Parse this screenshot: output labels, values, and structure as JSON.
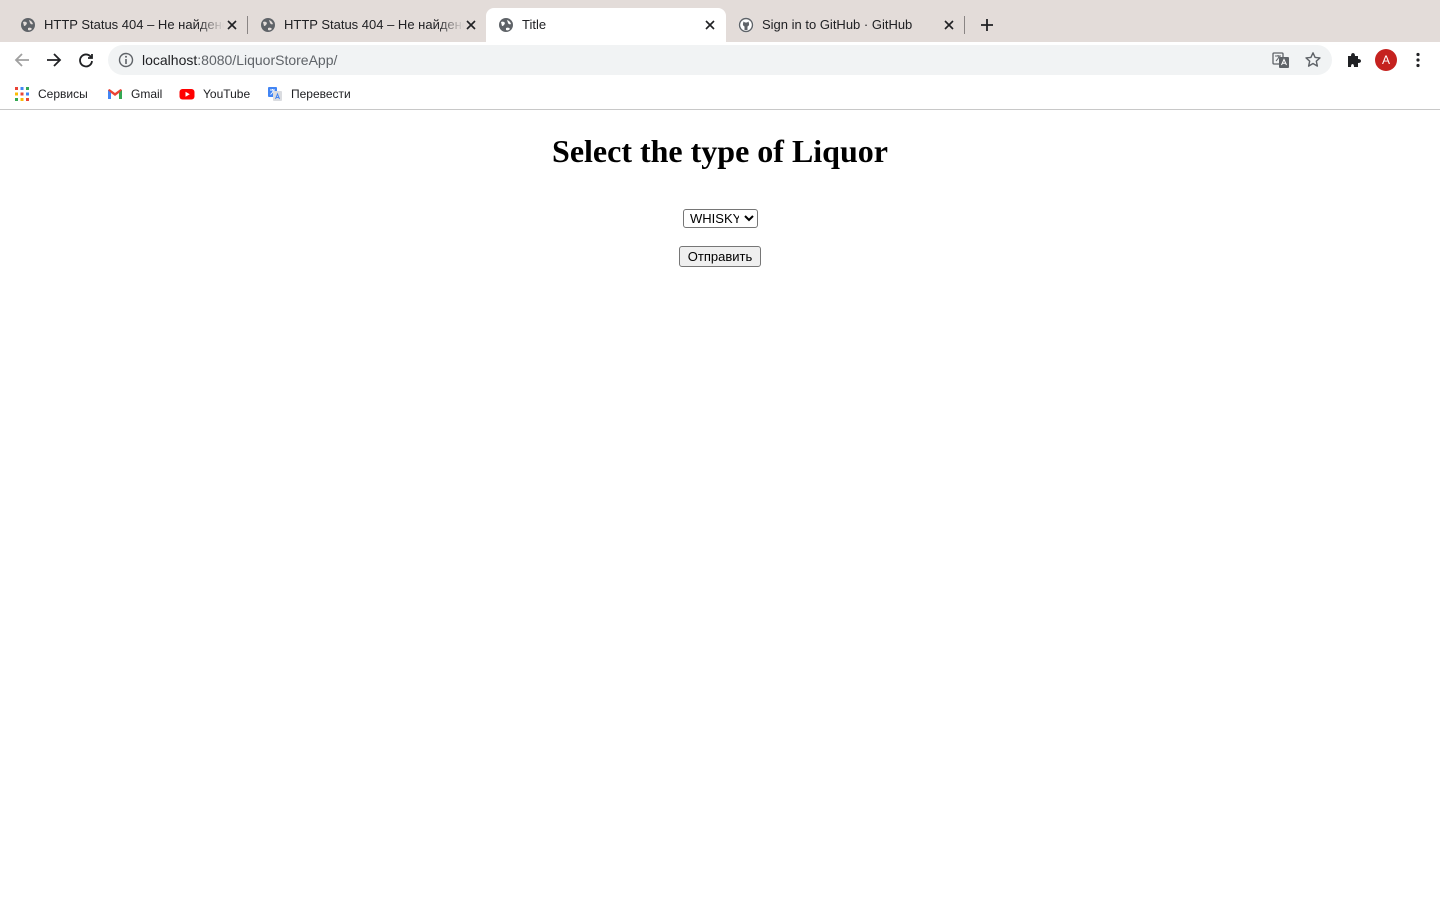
{
  "browser": {
    "tabs": [
      {
        "title": "HTTP Status 404 – Не найдено",
        "active": false
      },
      {
        "title": "HTTP Status 404 – Не найдено",
        "active": false
      },
      {
        "title": "Title",
        "active": true
      },
      {
        "title": "Sign in to GitHub · GitHub",
        "active": false
      }
    ],
    "address": {
      "host": "localhost",
      "path": ":8080/LiquorStoreApp/"
    },
    "profile_initial": "A",
    "accent_color": "#c5221f",
    "bookmarks": [
      {
        "label": "Сервисы",
        "icon": "apps-grid-icon"
      },
      {
        "label": "Gmail",
        "icon": "gmail-icon"
      },
      {
        "label": "YouTube",
        "icon": "youtube-icon"
      },
      {
        "label": "Перевести",
        "icon": "google-translate-icon"
      }
    ]
  },
  "page": {
    "heading": "Select the type of Liquor",
    "select": {
      "selected": "WHISKY"
    },
    "submit_label": "Отправить"
  }
}
